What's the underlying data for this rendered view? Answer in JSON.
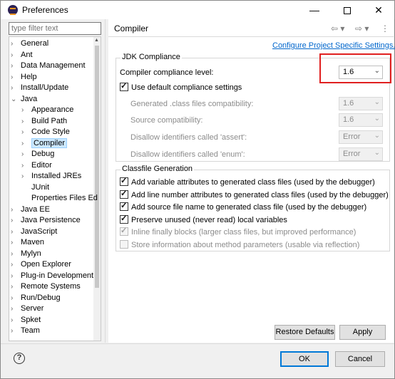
{
  "window": {
    "title": "Preferences",
    "min_glyph": "—",
    "close_glyph": "✕"
  },
  "filter": {
    "placeholder": "type filter text"
  },
  "tree": [
    {
      "label": "General",
      "arrow": "›",
      "indent": 0
    },
    {
      "label": "Ant",
      "arrow": "›",
      "indent": 0
    },
    {
      "label": "Data Management",
      "arrow": "›",
      "indent": 0
    },
    {
      "label": "Help",
      "arrow": "›",
      "indent": 0
    },
    {
      "label": "Install/Update",
      "arrow": "›",
      "indent": 0
    },
    {
      "label": "Java",
      "arrow": "⌄",
      "indent": 0
    },
    {
      "label": "Appearance",
      "arrow": "›",
      "indent": 1
    },
    {
      "label": "Build Path",
      "arrow": "›",
      "indent": 1
    },
    {
      "label": "Code Style",
      "arrow": "›",
      "indent": 1
    },
    {
      "label": "Compiler",
      "arrow": "›",
      "indent": 1,
      "selected": true
    },
    {
      "label": "Debug",
      "arrow": "›",
      "indent": 1
    },
    {
      "label": "Editor",
      "arrow": "›",
      "indent": 1
    },
    {
      "label": "Installed JREs",
      "arrow": "›",
      "indent": 1
    },
    {
      "label": "JUnit",
      "arrow": "",
      "indent": 1
    },
    {
      "label": "Properties Files Ed",
      "arrow": "",
      "indent": 1
    },
    {
      "label": "Java EE",
      "arrow": "›",
      "indent": 0
    },
    {
      "label": "Java Persistence",
      "arrow": "›",
      "indent": 0
    },
    {
      "label": "JavaScript",
      "arrow": "›",
      "indent": 0
    },
    {
      "label": "Maven",
      "arrow": "›",
      "indent": 0
    },
    {
      "label": "Mylyn",
      "arrow": "›",
      "indent": 0
    },
    {
      "label": "Open Explorer",
      "arrow": "›",
      "indent": 0
    },
    {
      "label": "Plug-in Development",
      "arrow": "›",
      "indent": 0
    },
    {
      "label": "Remote Systems",
      "arrow": "›",
      "indent": 0
    },
    {
      "label": "Run/Debug",
      "arrow": "›",
      "indent": 0
    },
    {
      "label": "Server",
      "arrow": "›",
      "indent": 0
    },
    {
      "label": "Spket",
      "arrow": "›",
      "indent": 0
    },
    {
      "label": "Team",
      "arrow": "›",
      "indent": 0
    }
  ],
  "page": {
    "title": "Compiler",
    "nav_back": "⇦ ▾",
    "nav_forward": "⇨ ▾",
    "nav_menu": "⋮",
    "configure_link": "Configure Project Specific Settings..."
  },
  "jdk": {
    "group_label": "JDK Compliance",
    "compliance_label": "Compiler compliance level:",
    "compliance_value": "1.6",
    "use_default_label": "Use default compliance settings",
    "use_default_checked": true,
    "settings": [
      {
        "label": "Generated .class files compatibility:",
        "value": "1.6"
      },
      {
        "label": "Source compatibility:",
        "value": "1.6"
      },
      {
        "label": "Disallow identifiers called 'assert':",
        "value": "Error"
      },
      {
        "label": "Disallow identifiers called 'enum':",
        "value": "Error"
      }
    ]
  },
  "classfile": {
    "group_label": "Classfile Generation",
    "options": [
      {
        "label": "Add variable attributes to generated class files (used by the debugger)",
        "checked": true,
        "enabled": true
      },
      {
        "label": "Add line number attributes to generated class files (used by the debugger)",
        "checked": true,
        "enabled": true
      },
      {
        "label": "Add source file name to generated class file (used by the debugger)",
        "checked": true,
        "enabled": true
      },
      {
        "label": "Preserve unused (never read) local variables",
        "checked": true,
        "enabled": true
      },
      {
        "label": "Inline finally blocks (larger class files, but improved performance)",
        "checked": true,
        "enabled": false
      },
      {
        "label": "Store information about method parameters (usable via reflection)",
        "checked": false,
        "enabled": false
      }
    ]
  },
  "buttons": {
    "restore_defaults": "Restore Defaults",
    "apply": "Apply",
    "ok": "OK",
    "cancel": "Cancel"
  },
  "help_glyph": "?",
  "colors": {
    "link": "#0066cc",
    "highlight": "#e02020",
    "selection": "#cce8ff"
  }
}
